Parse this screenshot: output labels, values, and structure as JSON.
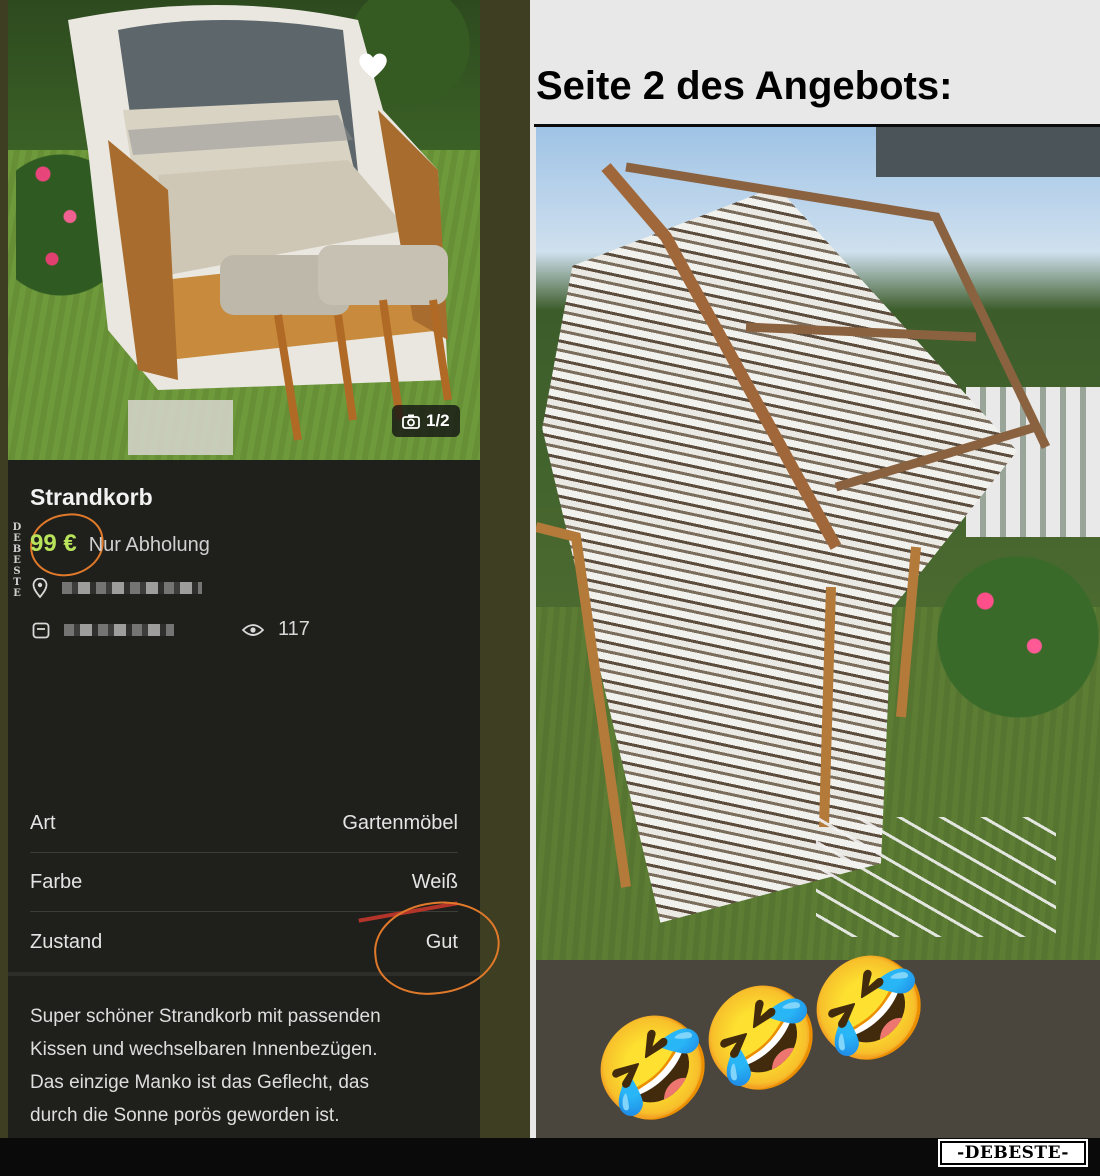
{
  "listing": {
    "photo_counter": "1/2",
    "title": "Strandkorb",
    "price": "99 €",
    "pickup": "Nur Abholung",
    "views": "117",
    "attributes": [
      {
        "label": "Art",
        "value": "Gartenmöbel"
      },
      {
        "label": "Farbe",
        "value": "Weiß"
      },
      {
        "label": "Zustand",
        "value": "Gut"
      }
    ],
    "description_lines": [
      "Super schöner Strandkorb mit passenden",
      "Kissen und wechselbaren Innenbezügen.",
      "Das einzige Manko ist das Geflecht, das",
      "durch die Sonne porös geworden ist."
    ],
    "watermark_vertical": "DEBESTE",
    "icons": [
      "heart-icon",
      "camera-icon",
      "location-pin-icon",
      "calendar-icon",
      "eye-icon"
    ]
  },
  "page2": {
    "headline": "Seite 2 des Angebots:",
    "emojis": [
      "🤣",
      "🤣",
      "🤣"
    ]
  },
  "watermark": "-DEBESTE-",
  "colors": {
    "price_green": "#b9e35a",
    "annotation_orange": "#e07a2a",
    "listing_bg": "#1f1f1c"
  }
}
